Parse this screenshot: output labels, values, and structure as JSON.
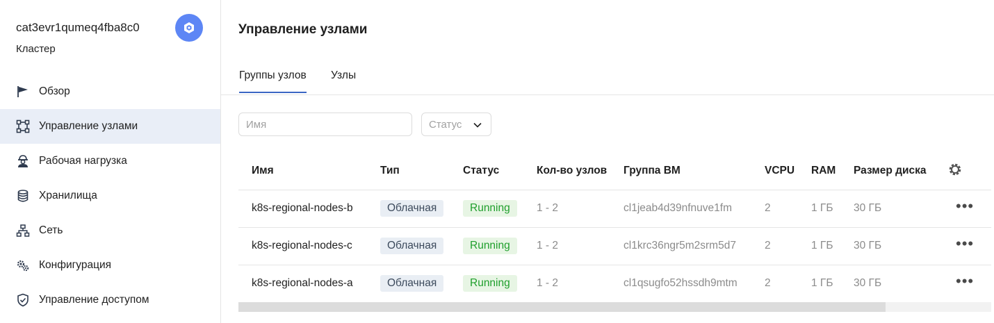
{
  "sidebar": {
    "cluster_id": "cat3evr1qumeq4fba8c0",
    "cluster_label": "Кластер",
    "items": [
      {
        "label": "Обзор",
        "icon": "flag-icon",
        "active": false
      },
      {
        "label": "Управление узлами",
        "icon": "nodes-frame-icon",
        "active": true
      },
      {
        "label": "Рабочая нагрузка",
        "icon": "worker-icon",
        "active": false
      },
      {
        "label": "Хранилища",
        "icon": "database-icon",
        "active": false
      },
      {
        "label": "Сеть",
        "icon": "network-icon",
        "active": false
      },
      {
        "label": "Конфигурация",
        "icon": "gears-icon",
        "active": false
      },
      {
        "label": "Управление доступом",
        "icon": "shield-icon",
        "active": false
      }
    ]
  },
  "main": {
    "title": "Управление узлами",
    "tabs": [
      {
        "label": "Группы узлов",
        "active": true
      },
      {
        "label": "Узлы",
        "active": false
      }
    ],
    "filters": {
      "search_placeholder": "Имя",
      "status_placeholder": "Статус"
    },
    "table": {
      "columns": [
        "Имя",
        "Тип",
        "Статус",
        "Кол-во узлов",
        "Группа ВМ",
        "VCPU",
        "RAM",
        "Размер диска"
      ],
      "rows": [
        {
          "name": "k8s-regional-nodes-b",
          "type": "Облачная",
          "status": "Running",
          "count": "1 - 2",
          "group": "cl1jeab4d39nfnuve1fm",
          "vcpu": "2",
          "ram": "1 ГБ",
          "disk": "30 ГБ"
        },
        {
          "name": "k8s-regional-nodes-c",
          "type": "Облачная",
          "status": "Running",
          "count": "1 - 2",
          "group": "cl1krc36ngr5m2srm5d7",
          "vcpu": "2",
          "ram": "1 ГБ",
          "disk": "30 ГБ"
        },
        {
          "name": "k8s-regional-nodes-a",
          "type": "Облачная",
          "status": "Running",
          "count": "1 - 2",
          "group": "cl1qsugfo52hssdh9mtm",
          "vcpu": "2",
          "ram": "1 ГБ",
          "disk": "30 ГБ"
        }
      ]
    }
  },
  "colors": {
    "accent": "#3b66c4",
    "active_nav_bg": "#e9eef7",
    "status_running": "#1f9f2c",
    "badge_blue": "#5d86f5"
  }
}
